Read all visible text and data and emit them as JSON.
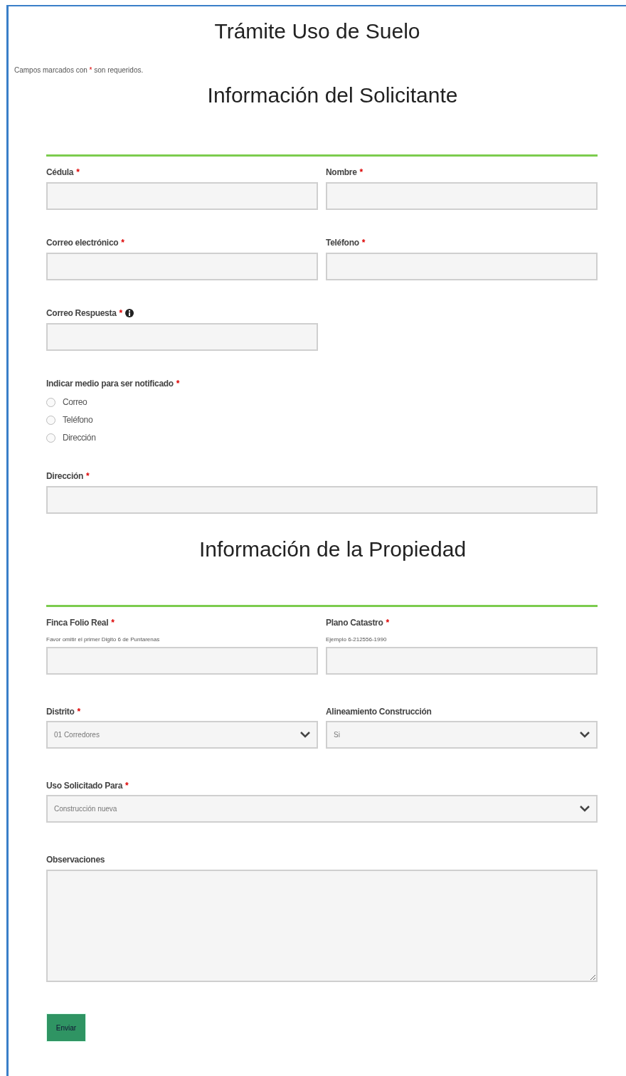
{
  "title": "Trámite Uso de Suelo",
  "required_mark": "*",
  "note": {
    "before": "Campos marcados con",
    "after": "son requeridos."
  },
  "sections": [
    {
      "heading": "Información del Solicitante",
      "rows": [
        [
          {
            "kind": "text",
            "label": "Cédula",
            "required": true
          },
          {
            "kind": "text",
            "label": "Nombre",
            "required": true
          }
        ],
        [
          {
            "kind": "text",
            "label": "Correo electrónico",
            "required": true
          },
          {
            "kind": "text",
            "label": "Teléfono",
            "required": true
          }
        ],
        [
          {
            "kind": "text",
            "label": "Correo Respuesta",
            "required": true,
            "info": true
          },
          {
            "kind": "empty"
          }
        ],
        [
          {
            "kind": "radio",
            "label": "Indicar medio para ser notificado",
            "required": true,
            "options": [
              {
                "label": "Correo",
                "selected": false
              },
              {
                "label": "Teléfono",
                "selected": false
              },
              {
                "label": "Dirección",
                "selected": false
              }
            ]
          }
        ],
        [
          {
            "kind": "text",
            "label": "Dirección",
            "required": true
          }
        ]
      ]
    },
    {
      "heading": "Información de la Propiedad",
      "rows": [
        [
          {
            "kind": "text",
            "label": "Finca Folio Real",
            "required": true,
            "hint": "Favor omitir el primer Digito 6 de Puntarenas"
          },
          {
            "kind": "text",
            "label": "Plano Catastro",
            "required": true,
            "hint": "Ejemplo 6-212556-1990"
          }
        ],
        [
          {
            "kind": "select",
            "label": "Distrito",
            "required": true,
            "value": "01 Corredores"
          },
          {
            "kind": "select",
            "label": "Alineamiento Construcción",
            "required": false,
            "value": "Si"
          }
        ],
        [
          {
            "kind": "select",
            "label": "Uso Solicitado Para",
            "required": true,
            "value": "Construcción nueva"
          }
        ],
        [
          {
            "kind": "textarea",
            "label": "Observaciones",
            "required": false
          }
        ]
      ]
    }
  ],
  "submit": "Enviar"
}
